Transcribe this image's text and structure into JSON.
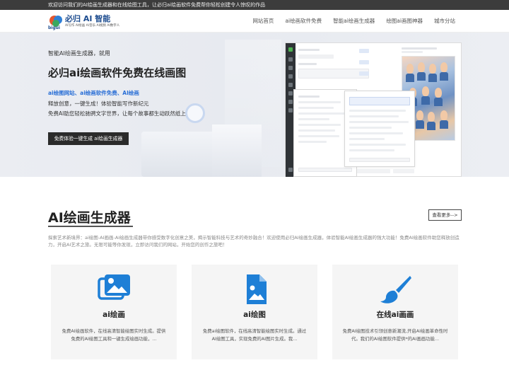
{
  "topbar": {
    "text": "欢迎访问我们的AI绘画生成器和在线绘图工具，让必归ai绘画软件免费帮你轻松创建令人惊叹的作品"
  },
  "logo": {
    "name": "必归",
    "suffix": "AI 智能",
    "tagline": "AI写作 AI绘画 AI音乐 AI视频 AI数字人",
    "mark_text": "bigui"
  },
  "nav": {
    "items": [
      {
        "label": "网站首页"
      },
      {
        "label": "ai绘画软件免费"
      },
      {
        "label": "智能ai绘画生成器"
      },
      {
        "label": "绘图ai画图神器"
      },
      {
        "label": "城市分站"
      }
    ]
  },
  "hero": {
    "kicker": "智能AI绘画生成器，就用",
    "title": "必归ai绘画软件免费在线画图",
    "links": "ai绘图网站、ai绘画软件免费、AI绘画",
    "line1": "释放创意，一键生成！体验智能写作新纪元",
    "line2": "免费AI助您轻松驰骋文字世界，让每个故事都生动跃然纸上",
    "cta": "免费体验一键生成 ai绘画生成器"
  },
  "section": {
    "title": "AI绘画生成器",
    "more": "查看更多-->",
    "intro": "探索艺术新境界：ai绘图-AI画画-AI绘画生成器带你感受数字化创意之美，揭示智能科技与艺术的奇妙融合！欢迎使用必归AI绘画生成器，体验智能AI绘画生成器的强大功能！免费AI绘画软件助您释放创造力，开启AI艺术之旅。无限可能等你发现，立即访问我们的网站，开始您的创作之旅吧！"
  },
  "cards": [
    {
      "title": "ai绘画",
      "icon": "images-icon",
      "desc": "免费AI绘画软件，在线高清智能绘图实时生成。提供免费的AI绘图工具和一键生成绘画功能，..."
    },
    {
      "title": "ai绘图",
      "icon": "image-file-icon",
      "desc": "免费ai绘图软件，在线高清智能绘图实时生成。通过AI绘图工具，实现免费的AI图片生成。我..."
    },
    {
      "title": "在线ai画画",
      "icon": "paint-brush-icon",
      "desc": "免费AI绘图技术引领创意新潮流,开启AI绘画革命性时代。我们的AI绘图软件提供*的AI画画功能..."
    }
  ],
  "colors": {
    "accent": "#1e7fd6",
    "topbar_bg": "#3c3c3c",
    "cta_bg": "#2b2b2b",
    "link": "#2a6fd6"
  }
}
